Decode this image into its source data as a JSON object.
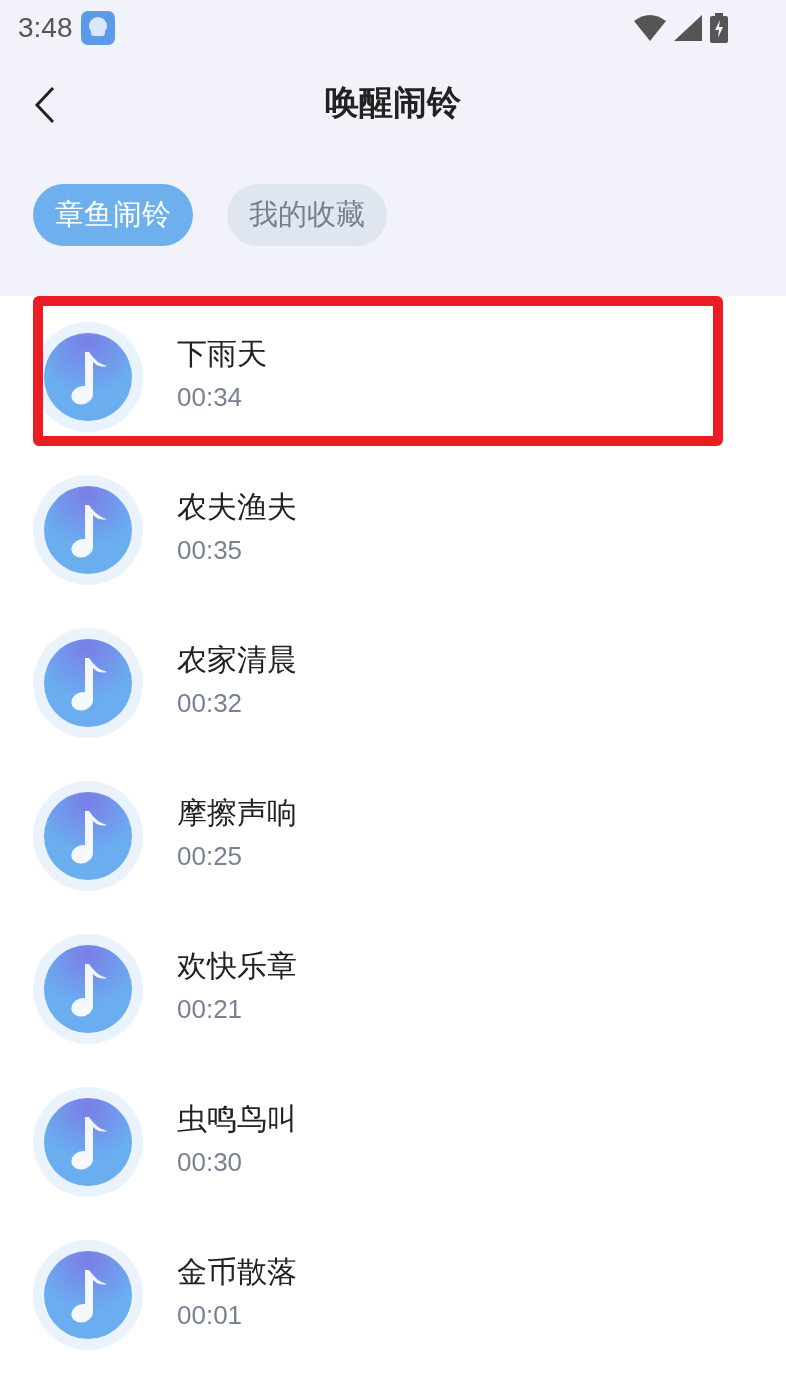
{
  "status_bar": {
    "time": "3:48"
  },
  "header": {
    "title": "唤醒闹铃"
  },
  "tabs": [
    {
      "label": "章鱼闹铃",
      "selected": true
    },
    {
      "label": "我的收藏",
      "selected": false
    }
  ],
  "ringtones": [
    {
      "name": "下雨天",
      "duration": "00:34",
      "highlighted": true
    },
    {
      "name": "农夫渔夫",
      "duration": "00:35",
      "highlighted": false
    },
    {
      "name": "农家清晨",
      "duration": "00:32",
      "highlighted": false
    },
    {
      "name": "摩擦声响",
      "duration": "00:25",
      "highlighted": false
    },
    {
      "name": "欢快乐章",
      "duration": "00:21",
      "highlighted": false
    },
    {
      "name": "虫鸣鸟叫",
      "duration": "00:30",
      "highlighted": false
    },
    {
      "name": "金币散落",
      "duration": "00:01",
      "highlighted": false
    }
  ]
}
